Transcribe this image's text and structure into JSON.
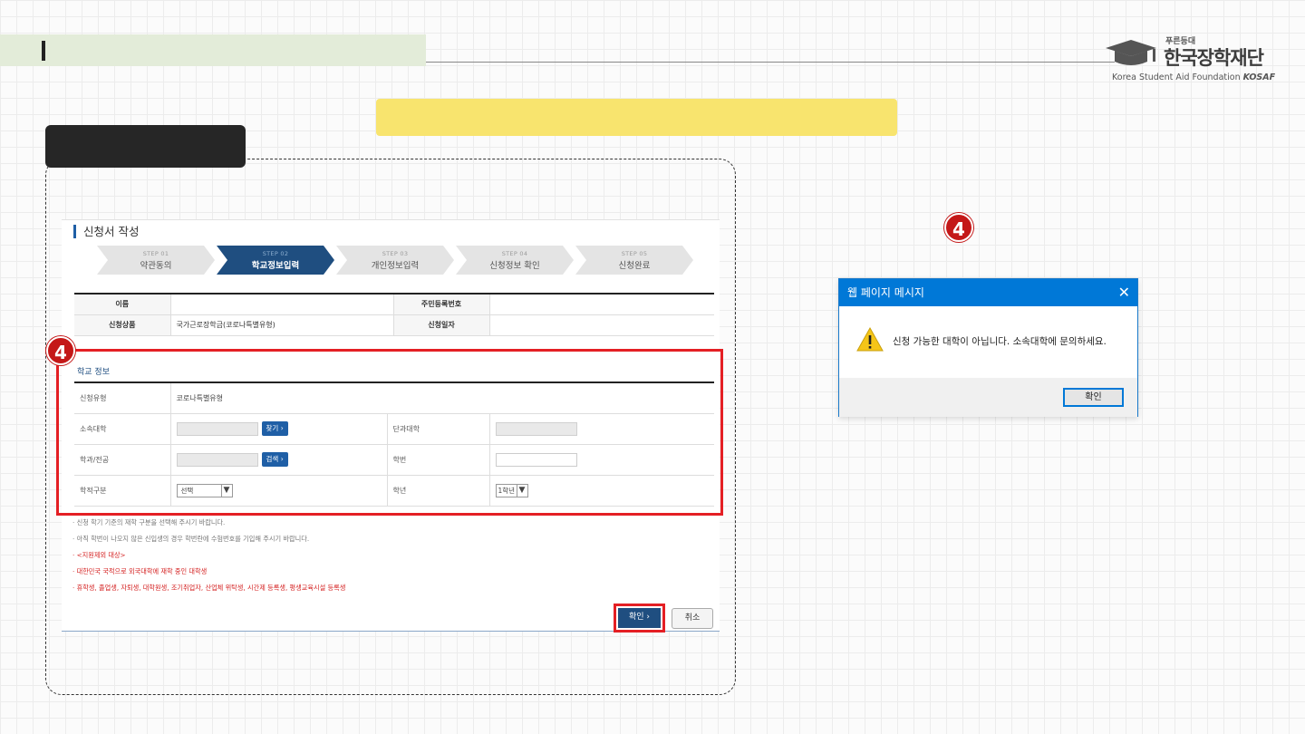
{
  "logo": {
    "tagline": "푸른등대",
    "name": "한국장학재단",
    "english": "Korea Student Aid Foundation",
    "abbr": "KOSAF"
  },
  "panel": {
    "title": "신청서 작성",
    "steps": [
      {
        "num": "STEP 01",
        "name": "약관동의",
        "active": false
      },
      {
        "num": "STEP 02",
        "name": "학교정보입력",
        "active": true
      },
      {
        "num": "STEP 03",
        "name": "개인정보입력",
        "active": false
      },
      {
        "num": "STEP 04",
        "name": "신청정보 확인",
        "active": false
      },
      {
        "num": "STEP 05",
        "name": "신청완료",
        "active": false
      }
    ],
    "info": {
      "name_label": "이름",
      "name_value": "",
      "rrn_label": "주민등록번호",
      "rrn_value": "",
      "product_label": "신청상품",
      "product_value": "국가근로장학금(코로나특별유형)",
      "date_label": "신청일자",
      "date_value": ""
    },
    "school": {
      "title": "학교 정보",
      "type_label": "신청유형",
      "type_value": "코로나특별유형",
      "univ_label": "소속대학",
      "find_button": "찾기",
      "college_label": "단과대학",
      "dept_label": "학과/전공",
      "search_button": "검색",
      "student_no_label": "학번",
      "status_label": "학적구분",
      "status_select": "선택",
      "year_label": "학년",
      "year_select": "1학년"
    },
    "notes": [
      "신청 학기 기준의 재학 구분을 선택해 주시기 바랍니다.",
      "아직 학번이 나오지 않은 신입생의 경우 학번란에 수험번호를 기입해 주시기 바랍니다."
    ],
    "red_notes": [
      "<지원제외 대상>",
      "대한민국 국적으로 외국대학에 재학 중인 대학생",
      "휴학생, 졸업생, 자퇴생, 대학원생, 조기취업자, 산업체 위탁생, 시간제 등록생, 평생교육시설 등록생"
    ],
    "confirm_button": "확인",
    "cancel_button": "취소"
  },
  "markers": [
    "4",
    "4"
  ],
  "dialog": {
    "title": "웹 페이지 메시지",
    "close_glyph": "✕",
    "message": "신청 가능한 대학이 아닙니다. 소속대학에 문의하세요.",
    "ok_button": "확인"
  }
}
